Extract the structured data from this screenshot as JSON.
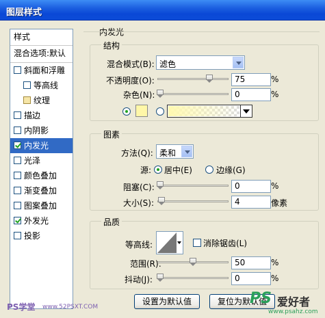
{
  "window": {
    "title": "图层样式"
  },
  "stylelist": {
    "header": "样式",
    "blend_options": "混合选项:默认",
    "items": [
      {
        "label": "斜面和浮雕",
        "checked": false,
        "sub": false,
        "selected": false
      },
      {
        "label": "等高线",
        "checked": false,
        "sub": true,
        "selected": false
      },
      {
        "label": "纹理",
        "checked": false,
        "sub": true,
        "selected": false
      },
      {
        "label": "描边",
        "checked": false,
        "sub": false,
        "selected": false
      },
      {
        "label": "内阴影",
        "checked": false,
        "sub": false,
        "selected": false
      },
      {
        "label": "内发光",
        "checked": true,
        "sub": false,
        "selected": true
      },
      {
        "label": "光泽",
        "checked": false,
        "sub": false,
        "selected": false
      },
      {
        "label": "颜色叠加",
        "checked": false,
        "sub": false,
        "selected": false
      },
      {
        "label": "渐变叠加",
        "checked": false,
        "sub": false,
        "selected": false
      },
      {
        "label": "图案叠加",
        "checked": false,
        "sub": false,
        "selected": false
      },
      {
        "label": "外发光",
        "checked": true,
        "sub": false,
        "selected": false
      },
      {
        "label": "投影",
        "checked": false,
        "sub": false,
        "selected": false
      }
    ]
  },
  "panel": {
    "title": "内发光",
    "structure": {
      "title": "结构",
      "blend_mode_label": "混合模式(B):",
      "blend_mode_value": "滤色",
      "opacity_label": "不透明度(O):",
      "opacity_value": "75",
      "opacity_level": 0.75,
      "noise_label": "杂色(N):",
      "noise_value": "0",
      "noise_level": 0.0,
      "percent": "%",
      "color_swatch": "#fff7a8",
      "gradient_from": "#fff9b0",
      "gradient_to": "transparent"
    },
    "elements": {
      "title": "图素",
      "method_label": "方法(Q):",
      "method_value": "柔和",
      "source_label": "源:",
      "center_label": "居中(E)",
      "edge_label": "边缘(G)",
      "choke_label": "阻塞(C):",
      "choke_value": "0",
      "choke_level": 0.0,
      "size_label": "大小(S):",
      "size_value": "4",
      "size_level": 0.02,
      "size_unit": "像素",
      "percent": "%"
    },
    "quality": {
      "title": "品质",
      "contour_label": "等高线:",
      "antialias_label": "消除锯齿(L)",
      "range_label": "范围(R):",
      "range_value": "50",
      "range_level": 0.5,
      "jitter_label": "抖动(J):",
      "jitter_value": "0",
      "jitter_level": 0.0,
      "percent": "%"
    },
    "buttons": {
      "set_default": "设置为默认值",
      "reset_default": "复位为默认值"
    }
  },
  "watermarks": {
    "left": "PS学堂",
    "left_url": "www.52PSXT.COM",
    "right_logo": "PS",
    "right_text": "爱好者",
    "right_url": "www.psahz.com"
  }
}
